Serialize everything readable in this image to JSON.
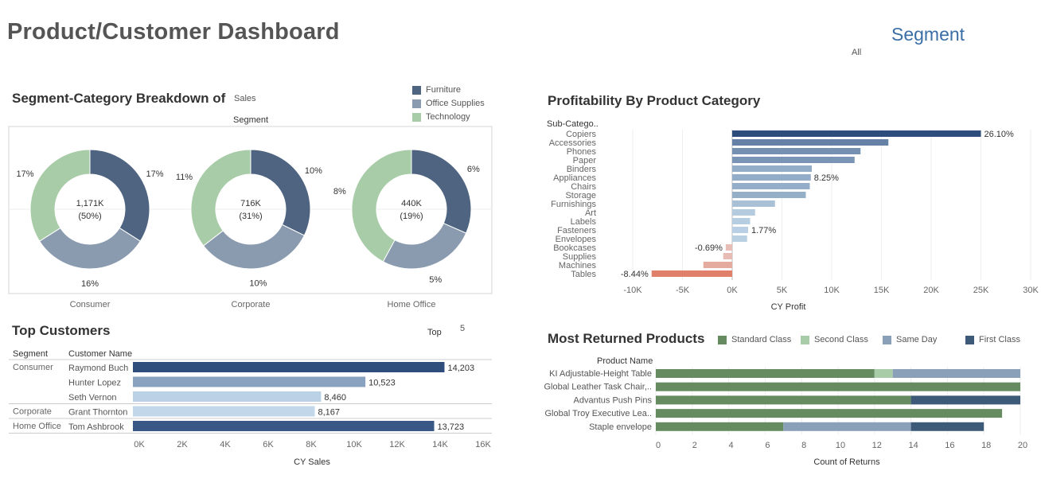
{
  "header": {
    "title": "Product/Customer Dashboard",
    "filter_label": "Segment",
    "filter_value": "All"
  },
  "colors": {
    "furniture": "#4e6480",
    "office_supplies": "#8a9bb0",
    "technology": "#a9cca8",
    "bar_dark": "#2e4d7c",
    "bar_light": "#c2d8ea",
    "negative": "#e07f6a",
    "standard_class": "#668b61",
    "second_class": "#a9cca8",
    "same_day": "#8aa0b8",
    "first_class": "#3d5a78"
  },
  "donut_panel": {
    "title": "Segment-Category Breakdown of",
    "measure": "Sales",
    "column_header": "Segment",
    "legend": [
      "Furniture",
      "Office Supplies",
      "Technology"
    ]
  },
  "profit_panel": {
    "title": "Profitability By Product Category",
    "row_header": "Sub-Catego..",
    "x_title": "CY Profit"
  },
  "customers_panel": {
    "title": "Top Customers",
    "top_label": "Top",
    "top_value": "5",
    "col_segment": "Segment",
    "col_customer": "Customer Name",
    "x_title": "CY Sales"
  },
  "returns_panel": {
    "title": "Most Returned Products",
    "row_header": "Product Name",
    "x_title": "Count of Returns"
  },
  "chart_data": [
    {
      "type": "pie",
      "title": "Segment-Category Breakdown of Sales",
      "categories": [
        "Furniture",
        "Office Supplies",
        "Technology"
      ],
      "series": [
        {
          "name": "Consumer",
          "total_label": "1,171K",
          "share_label": "(50%)",
          "values": [
            17,
            16,
            17
          ]
        },
        {
          "name": "Corporate",
          "total_label": "716K",
          "share_label": "(31%)",
          "values": [
            10,
            10,
            11
          ]
        },
        {
          "name": "Home Office",
          "total_label": "440K",
          "share_label": "(19%)",
          "values": [
            6,
            5,
            8
          ]
        }
      ],
      "legend_position": "top-right"
    },
    {
      "type": "bar",
      "orientation": "horizontal",
      "title": "Profitability By Product Category",
      "categories": [
        "Copiers",
        "Accessories",
        "Phones",
        "Paper",
        "Binders",
        "Appliances",
        "Chairs",
        "Storage",
        "Furnishings",
        "Art",
        "Labels",
        "Fasteners",
        "Envelopes",
        "Bookcases",
        "Supplies",
        "Machines",
        "Tables"
      ],
      "values": [
        25000,
        15700,
        12900,
        12300,
        8000,
        7900,
        7800,
        7400,
        4300,
        2300,
        1800,
        1600,
        1500,
        -650,
        -900,
        -2900,
        -8100
      ],
      "data_labels": {
        "Copiers": "26.10%",
        "Appliances": "8.25%",
        "Fasteners": "1.77%",
        "Bookcases": "-0.69%",
        "Tables": "-8.44%"
      },
      "xlabel": "CY Profit",
      "ylabel": "Sub-Catego..",
      "xlim": [
        -10000,
        30000
      ],
      "xticks": [
        -10000,
        -5000,
        0,
        5000,
        10000,
        15000,
        20000,
        25000,
        30000
      ],
      "xtick_labels": [
        "-10K",
        "-5K",
        "0K",
        "5K",
        "10K",
        "15K",
        "20K",
        "25K",
        "30K"
      ],
      "grid": true
    },
    {
      "type": "bar",
      "orientation": "horizontal",
      "title": "Top Customers",
      "rows": [
        {
          "segment": "Consumer",
          "customer": "Raymond Buch",
          "value": 14203,
          "label": "14,203"
        },
        {
          "segment": "",
          "customer": "Hunter Lopez",
          "value": 10523,
          "label": "10,523"
        },
        {
          "segment": "",
          "customer": "Seth Vernon",
          "value": 8460,
          "label": "8,460"
        },
        {
          "segment": "Corporate",
          "customer": "Grant Thornton",
          "value": 8167,
          "label": "8,167"
        },
        {
          "segment": "Home Office",
          "customer": "Tom Ashbrook",
          "value": 13723,
          "label": "13,723"
        }
      ],
      "xlabel": "CY Sales",
      "xlim": [
        0,
        16000
      ],
      "xticks": [
        0,
        2000,
        4000,
        6000,
        8000,
        10000,
        12000,
        14000,
        16000
      ],
      "xtick_labels": [
        "0K",
        "2K",
        "4K",
        "6K",
        "8K",
        "10K",
        "12K",
        "14K",
        "16K"
      ]
    },
    {
      "type": "bar",
      "orientation": "horizontal",
      "stacked": true,
      "title": "Most Returned Products",
      "categories": [
        "KI Adjustable-Height Table",
        "Global Leather Task Chair,..",
        "Advantus Push Pins",
        "Global Troy Executive Lea..",
        "Staple envelope"
      ],
      "series": [
        {
          "name": "Standard Class",
          "values": [
            12,
            20,
            14,
            19,
            7
          ]
        },
        {
          "name": "Second Class",
          "values": [
            1,
            0,
            0,
            0,
            0
          ]
        },
        {
          "name": "Same Day",
          "values": [
            7,
            0,
            0,
            0,
            7
          ]
        },
        {
          "name": "First Class",
          "values": [
            0,
            0,
            6,
            0,
            4
          ]
        }
      ],
      "xlabel": "Count of Returns",
      "xlim": [
        0,
        20
      ],
      "xticks": [
        0,
        2,
        4,
        6,
        8,
        10,
        12,
        14,
        16,
        18,
        20
      ],
      "legend_position": "top"
    }
  ]
}
